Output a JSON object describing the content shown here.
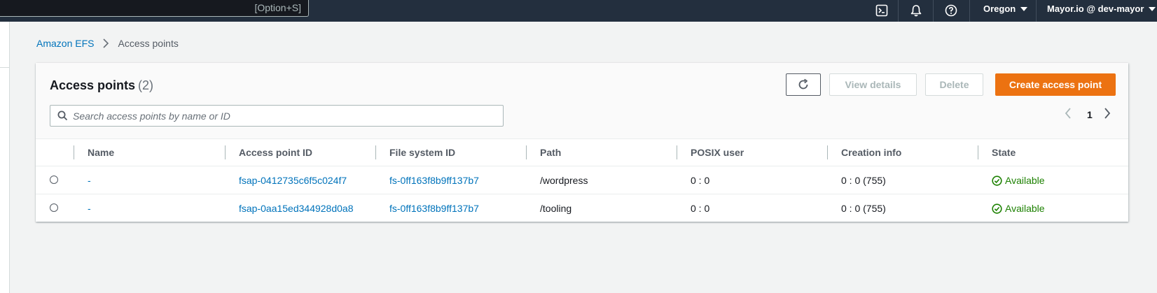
{
  "topbar": {
    "shortcut_hint": "[Option+S]",
    "region": "Oregon",
    "account": "Mayor.io @ dev-mayor",
    "icons": [
      "cloudshell-icon",
      "bell-icon",
      "help-icon"
    ]
  },
  "breadcrumb": {
    "root": "Amazon EFS",
    "current": "Access points"
  },
  "panel": {
    "title": "Access points",
    "count": "(2)",
    "buttons": {
      "view_details": "View details",
      "delete": "Delete",
      "create": "Create access point"
    },
    "search_placeholder": "Search access points by name or ID",
    "page": "1"
  },
  "table": {
    "headers": [
      "Name",
      "Access point ID",
      "File system ID",
      "Path",
      "POSIX user",
      "Creation info",
      "State"
    ],
    "rows": [
      {
        "name": "-",
        "ap_id": "fsap-0412735c6f5c024f7",
        "fs_id": "fs-0ff163f8b9ff137b7",
        "path": "/wordpress",
        "posix": "0 : 0",
        "creation": "0 : 0 (755)",
        "state": "Available"
      },
      {
        "name": "-",
        "ap_id": "fsap-0aa15ed344928d0a8",
        "fs_id": "fs-0ff163f8b9ff137b7",
        "path": "/tooling",
        "posix": "0 : 0",
        "creation": "0 : 0 (755)",
        "state": "Available"
      }
    ]
  },
  "colors": {
    "topbar": "#232f3e",
    "link": "#0073bb",
    "primary": "#ec7211",
    "success": "#1d8102"
  }
}
